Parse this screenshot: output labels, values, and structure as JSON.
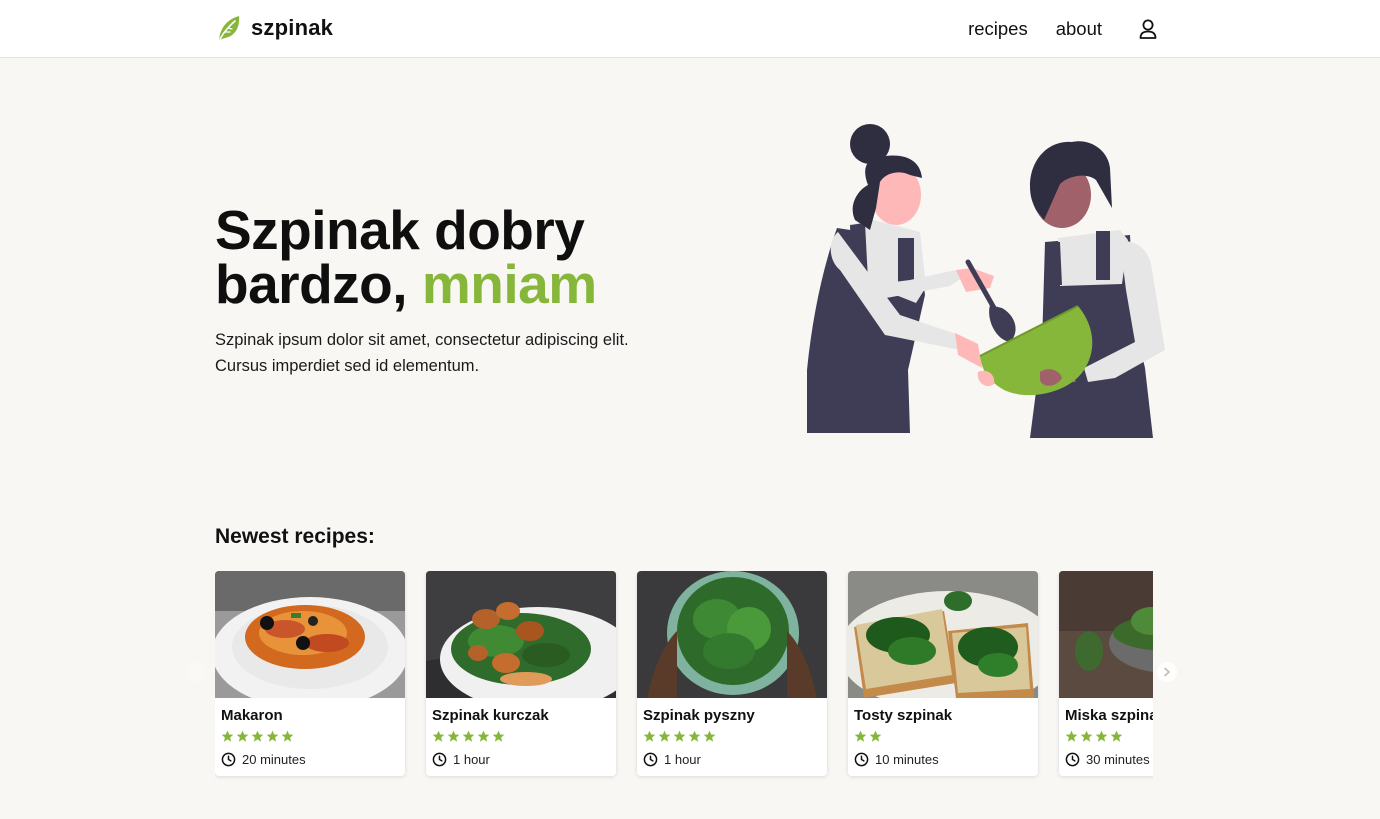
{
  "brand": {
    "name": "szpinak",
    "logo_icon": "leaf-icon",
    "accent_color": "#86b73a"
  },
  "nav": {
    "recipes": "recipes",
    "about": "about",
    "account_icon": "user-icon"
  },
  "hero": {
    "title_line1": "Szpinak dobry",
    "title_line2_prefix": "bardzo,",
    "title_line2_accent": "mniam",
    "subtitle": "Szpinak ipsum dolor sit amet, consectetur adipiscing elit. Cursus imperdiet sed id elementum.",
    "illustration": "two-people-cooking-with-green-bowl"
  },
  "newest": {
    "heading": "Newest recipes:",
    "recipes": [
      {
        "title": "Makaron",
        "rating": 5,
        "time": "20 minutes",
        "image": "pasta-plate"
      },
      {
        "title": "Szpinak kurczak",
        "rating": 5,
        "time": "1 hour",
        "image": "chicken-spinach-plate"
      },
      {
        "title": "Szpinak pyszny",
        "rating": 5,
        "time": "1 hour",
        "image": "spinach-bowl-in-hands"
      },
      {
        "title": "Tosty szpinak",
        "rating": 2,
        "time": "10 minutes",
        "image": "spinach-toast"
      },
      {
        "title": "Miska szpinak",
        "rating": 4,
        "time": "30 minutes",
        "image": "spinach-bowl-dark"
      }
    ]
  }
}
